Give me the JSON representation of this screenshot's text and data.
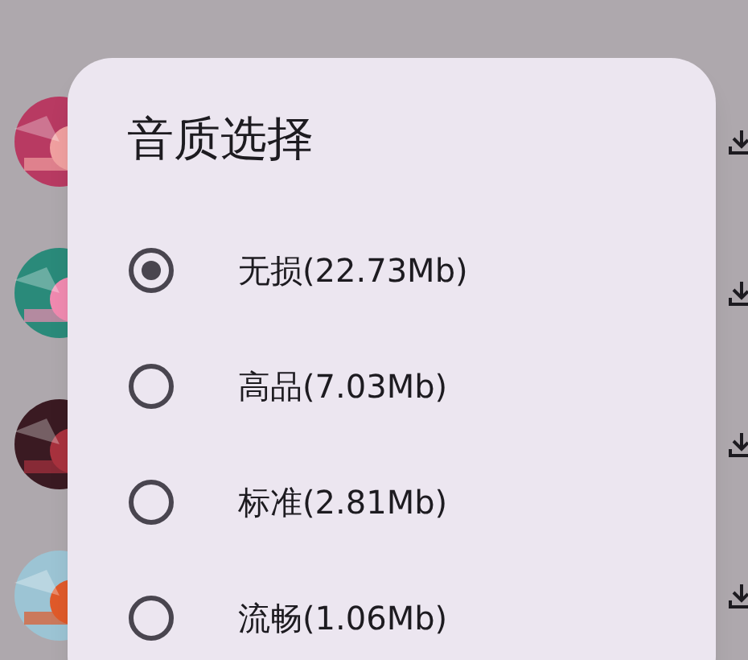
{
  "dialog": {
    "title": "音质选择",
    "options": [
      {
        "label": "无损(22.73Mb)",
        "selected": true
      },
      {
        "label": "高品(7.03Mb)",
        "selected": false
      },
      {
        "label": "标准(2.81Mb)",
        "selected": false
      },
      {
        "label": "流畅(1.06Mb)",
        "selected": false
      }
    ]
  }
}
